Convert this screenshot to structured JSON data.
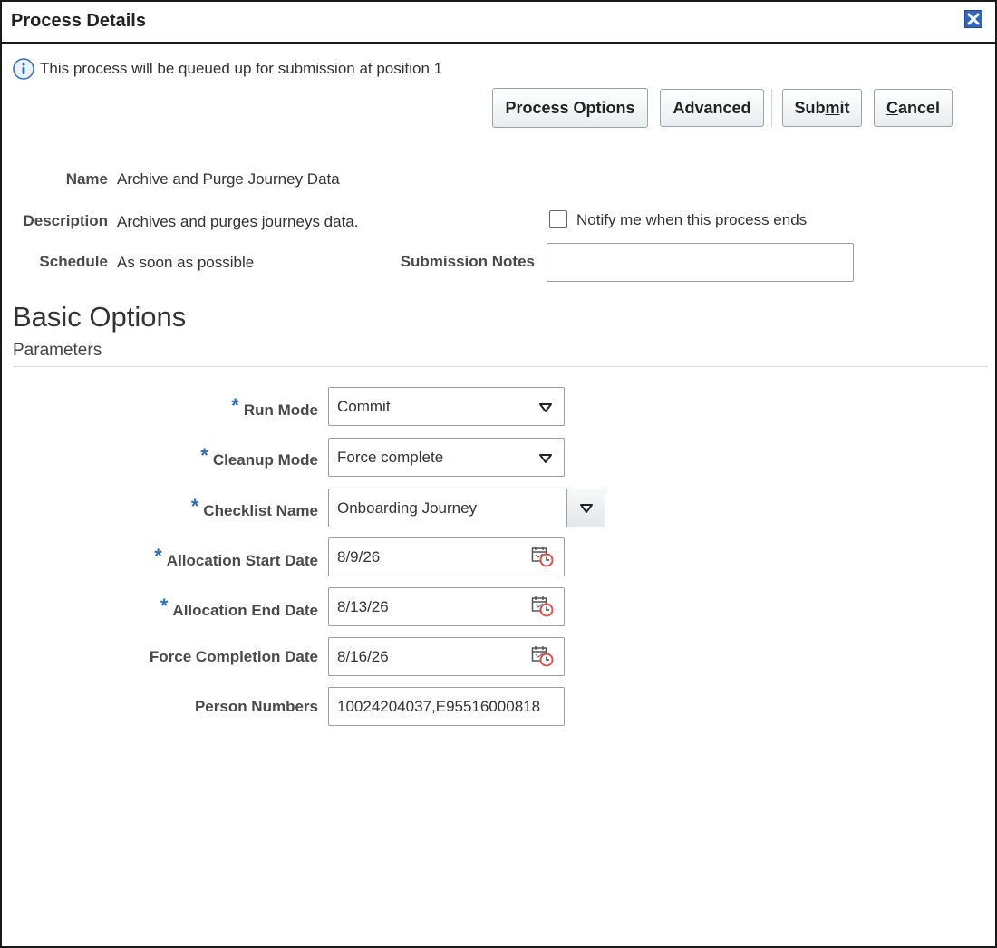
{
  "dialog": {
    "title": "Process Details",
    "close_icon": "close-icon",
    "info_message": "This process will be queued up for submission at position 1",
    "info_icon": "info-icon"
  },
  "toolbar": {
    "process_options_label": "Process Options",
    "advanced_label": "Advanced",
    "submit_pre": "Sub",
    "submit_underline": "m",
    "submit_post": "it",
    "cancel_underline": "C",
    "cancel_post": "ancel"
  },
  "details": {
    "name_label": "Name",
    "name_value": "Archive and Purge Journey Data",
    "description_label": "Description",
    "description_value": "Archives and purges journeys data.",
    "schedule_label": "Schedule",
    "schedule_value": "As soon as possible",
    "notify_label": "Notify me when this process ends",
    "notify_checked": false,
    "submission_notes_label": "Submission Notes",
    "submission_notes_value": ""
  },
  "basic_options": {
    "title": "Basic Options",
    "parameters_title": "Parameters"
  },
  "parameters": {
    "required_marker": "*",
    "run_mode_label": "Run Mode",
    "run_mode_value": "Commit",
    "cleanup_mode_label": "Cleanup Mode",
    "cleanup_mode_value": "Force complete",
    "checklist_name_label": "Checklist Name",
    "checklist_name_value": "Onboarding Journey",
    "allocation_start_date_label": "Allocation Start Date",
    "allocation_start_date_value": "8/9/26",
    "allocation_end_date_label": "Allocation End Date",
    "allocation_end_date_value": "8/13/26",
    "force_completion_date_label": "Force Completion Date",
    "force_completion_date_value": "8/16/26",
    "person_numbers_label": "Person Numbers",
    "person_numbers_value": "10024204037,E95516000818"
  },
  "colors": {
    "required_star": "#2a6eb5",
    "close_button": "#3266b8",
    "info_icon": "#2f6fb5",
    "calendar_clock": "#d9534f"
  }
}
